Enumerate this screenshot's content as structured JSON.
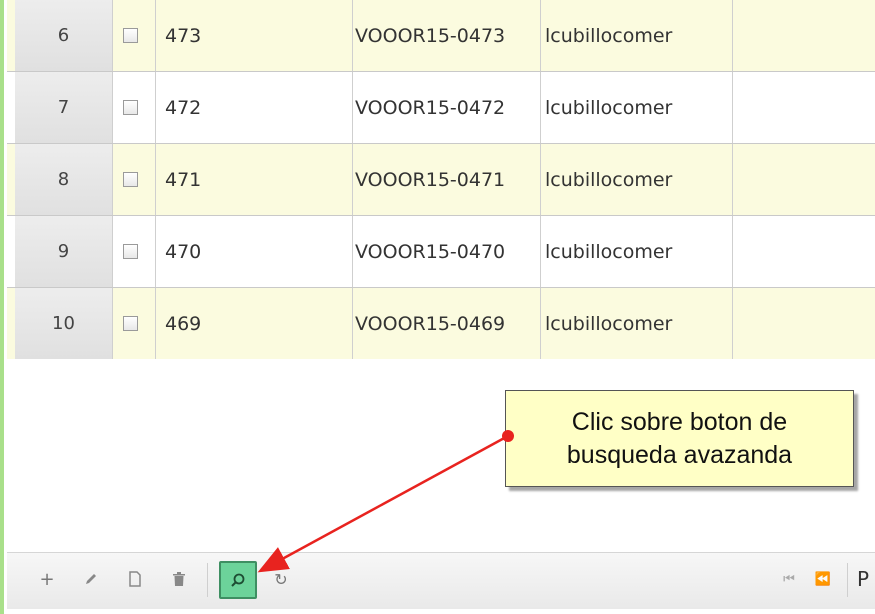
{
  "rows": [
    {
      "num": "6",
      "id": "473",
      "code": "VOOOR15-0473",
      "user": "lcubillocomer"
    },
    {
      "num": "7",
      "id": "472",
      "code": "VOOOR15-0472",
      "user": "lcubillocomer"
    },
    {
      "num": "8",
      "id": "471",
      "code": "VOOOR15-0471",
      "user": "lcubillocomer"
    },
    {
      "num": "9",
      "id": "470",
      "code": "VOOOR15-0470",
      "user": "lcubillocomer"
    },
    {
      "num": "10",
      "id": "469",
      "code": "VOOOR15-0469",
      "user": "lcubillocomer"
    }
  ],
  "callout": {
    "line1": "Clic sobre boton de",
    "line2": "busqueda avazanda"
  },
  "pager": {
    "page_label_partial": "P"
  },
  "icons": {
    "add": "plus-icon",
    "edit": "pencil-icon",
    "view": "document-icon",
    "delete": "trash-icon",
    "search": "magnifier-icon",
    "refresh": "refresh-icon",
    "first": "first-page-icon",
    "prev": "prev-page-icon"
  },
  "colors": {
    "alt_row": "#fbfbdf",
    "search_highlight": "#6cd39a",
    "callout_bg": "#ffffc6",
    "arrow": "#e8231f",
    "left_border": "#a9e08a"
  }
}
